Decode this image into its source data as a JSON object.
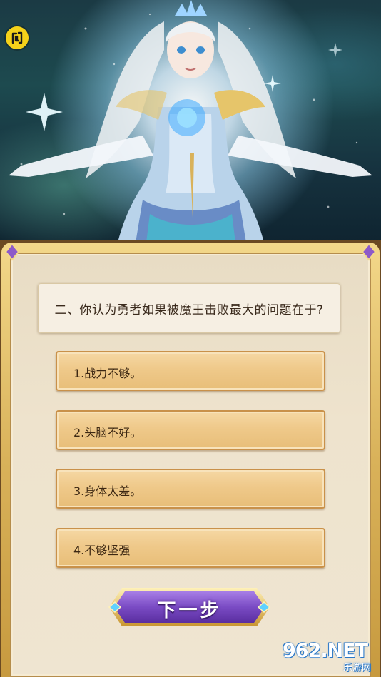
{
  "hero": {
    "close_icon": "close-glyph-icon"
  },
  "question": {
    "text": "二、你认为勇者如果被魔王击败最大的问题在于?"
  },
  "options": [
    {
      "label": "1.战力不够。"
    },
    {
      "label": "2.头脑不好。"
    },
    {
      "label": "3.身体太差。"
    },
    {
      "label": "4.不够坚强"
    }
  ],
  "next_button": {
    "label": "下一步"
  },
  "watermark": {
    "brand": "962.NET",
    "sub": "乐游网"
  },
  "colors": {
    "accent_yellow": "#f5d21a",
    "panel_gold": "#d9b25a",
    "option_fill": "#efc98a",
    "button_purple": "#7a4bc4"
  }
}
